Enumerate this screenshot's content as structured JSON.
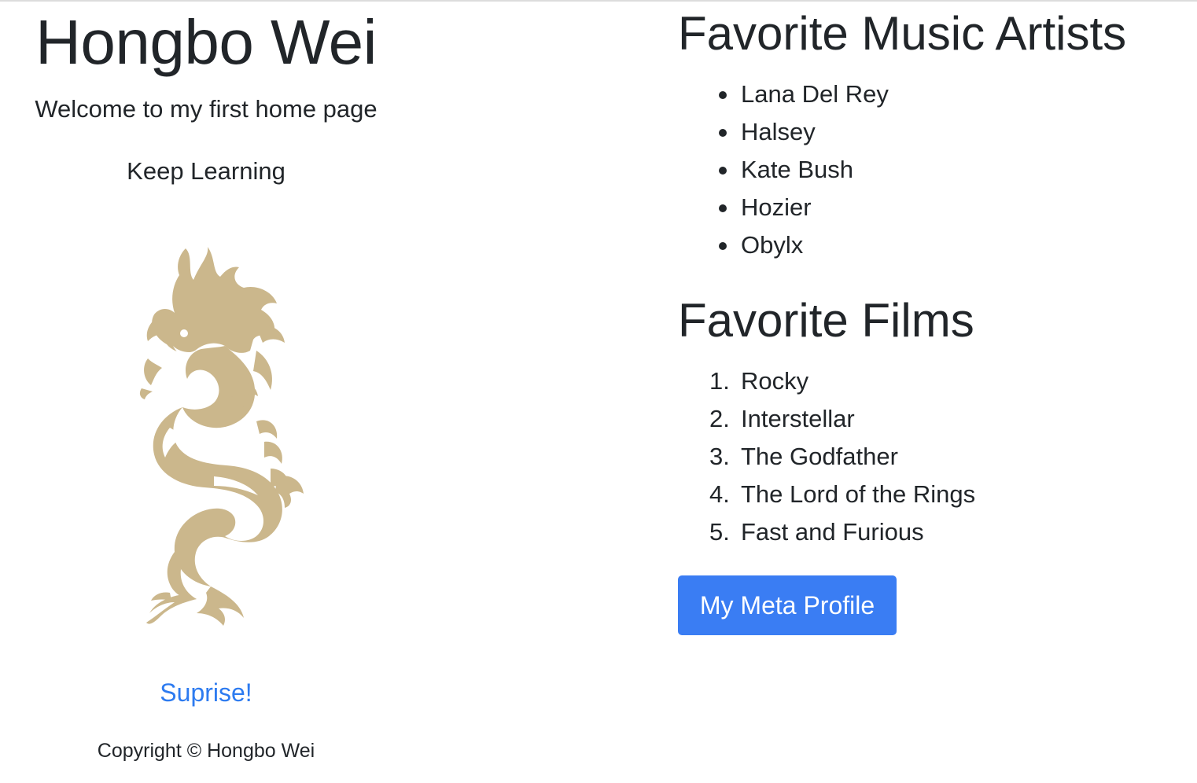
{
  "profile": {
    "name": "Hongbo Wei",
    "welcome": "Welcome to my first home page",
    "motto": "Keep Learning",
    "image_icon": "dragon-icon",
    "image_color": "#cbb78c",
    "surprise_link": "Suprise!",
    "copyright": "Copyright © Hongbo Wei"
  },
  "music": {
    "heading": "Favorite Music Artists",
    "items": [
      "Lana Del Rey",
      "Halsey",
      "Kate Bush",
      "Hozier",
      "Obylx"
    ]
  },
  "films": {
    "heading": "Favorite Films",
    "numbers": [
      "1.",
      "2.",
      "3.",
      "4.",
      "5."
    ],
    "items": [
      "Rocky",
      "Interstellar",
      "The Godfather",
      "The Lord of the Rings",
      "Fast and Furious"
    ]
  },
  "button": {
    "label": "My Meta Profile",
    "color": "#3a7df3"
  },
  "colors": {
    "text": "#212529",
    "link": "#2d7bf0"
  }
}
